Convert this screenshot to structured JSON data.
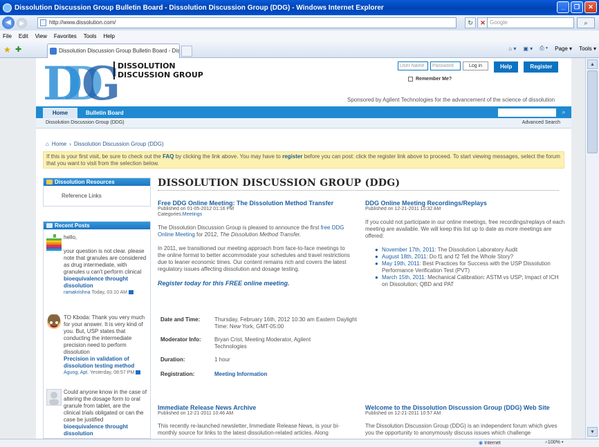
{
  "browser": {
    "window_title": "Dissolution Discussion Group Bulletin Board - Dissolution Discussion Group (DDG) - Windows Internet Explorer",
    "url": "http://www.dissolution.com/",
    "search_placeholder": "Google",
    "menu": [
      "File",
      "Edit",
      "View",
      "Favorites",
      "Tools",
      "Help"
    ],
    "tab_title": "Dissolution Discussion Group Bulletin Board - Dissolutio...",
    "cmd_page": "Page",
    "cmd_tools": "Tools",
    "status_zone": "Internet",
    "status_zoom": "100%"
  },
  "site": {
    "logo_text": "DDG",
    "brand_line1": "DISSOLUTION",
    "brand_line2": "DISCUSSION GROUP",
    "username_placeholder": "User Name",
    "password_placeholder": "Password",
    "login_label": "Log in",
    "help_label": "Help",
    "register_label": "Register",
    "remember_label": "Remember Me?",
    "sponsor": "Sponsored by Agilent Technologies for the advancement of the science of dissolution",
    "nav_home": "Home",
    "nav_bulletin": "Bulletin Board",
    "crumb": "Dissolution Discussion Group (DDG)",
    "advanced_search": "Advanced Search",
    "home_crumb_home": "Home",
    "home_crumb_sep": "›",
    "home_crumb_page": "Dissolution Discussion Group (DDG)",
    "notice_a": "If this is your first visit, be sure to check out the ",
    "notice_faq": "FAQ",
    "notice_b": " by clicking the link above. You may have to ",
    "notice_register": "register",
    "notice_c": " before you can post: click the register link above to proceed. To start viewing messages, select the forum that you want to visit from the selection below."
  },
  "sidebar": {
    "resources_title": "Dissolution Resources",
    "reference_links": "Reference Links",
    "recent_title": "Recent Posts",
    "posts": [
      {
        "text": "hello,\n\nyour question is not clear. please note that granules are considered as drug intermediate, with granules u can't perform clinical",
        "thread": "bioequivalence throught dissolution",
        "author": "ramakrishna",
        "when": "Today, 03:10 AM"
      },
      {
        "text": "TO Kboda: Thank you very much for your answer. It is very kind of you. But, USP states that conducting the intermediate precision need to perform dissolution",
        "thread": "Precision in validation of dissolution testing method",
        "author": "Agung, Apt.",
        "when": "Yesterday, 08:57 PM"
      },
      {
        "text": "Could anyone know in the case of altering the dosage form to oral granule from tablet, are the clinical trials obligated or can the case be justified",
        "thread": "bioequivalence throught dissolution",
        "author": "",
        "when": ""
      }
    ]
  },
  "main": {
    "title": "DISSOLUTION DISCUSSION GROUP (DDG)",
    "a1": {
      "title": "Free DDG Online Meeting: The Dissolution Method Transfer",
      "published": "Published on 01-05-2012 01:16 PM",
      "categories_label": "Categories:",
      "categories_value": "Meetings",
      "p1a": "The Dissolution Discussion Group is pleased to announce the first ",
      "p1link": "free DDG Online Meeting",
      "p1b": " for 2012, ",
      "p1i": "The Dissolution Method Transfer.",
      "p2": "In 2011, we transitioned our meeting approach from face-to-face meetings to the online format to better accommodate your schedules and travel restrictions due to leaner economic times. Our content remains rich and covers the latest regulatory issues affecting dissolution and dosage testing.",
      "reg_link": "Register today",
      "reg_rest": " for this FREE online meeting.",
      "details": [
        {
          "k": "Date and Time:",
          "v": "Thursday, February 16th, 2012 10:30 am Eastern Daylight Time: New York, GMT-05:00"
        },
        {
          "k": "Moderator Info:",
          "v": "Bryan Crist, Meeting Moderator, Agilent Technologies"
        },
        {
          "k": "Duration:",
          "v": "1 hour"
        },
        {
          "k": "Registration:",
          "v": "Meeting Information"
        }
      ]
    },
    "a2": {
      "title": "DDG Online Meeting Recordings/Replays",
      "published": "Published on 12-21-2011 10:32 AM",
      "p1": "If you could not participate in our online meetings, free recordings/replays of each meeting are available. We will keep this list up to date as more meetings are offered:",
      "items": [
        {
          "d": "November 17th, 2011",
          "t": ": The Dissolution Laboratory Audit"
        },
        {
          "d": "August 18th, 2011",
          "t": ": Do f1 and f2 Tell the Whole Story?"
        },
        {
          "d": "May 19th, 2011",
          "t": ": Best Practices for Success with the USP Dissolution Performance Verification Test (PVT)"
        },
        {
          "d": "March 15th, 2011",
          "t": ": Mechanical Calibration: ASTM vs USP; Impact of ICH on Dissolution; QBD and PAT"
        }
      ]
    },
    "a3": {
      "title": "Immediate Release News Archive",
      "published": "Published on 12-21-2011 10:46 AM",
      "p1": "This recently re-launched newsletter, Immediate Release News, is your bi-monthly source for links to the latest dissolution-related articles. Along"
    },
    "a4": {
      "title": "Welcome to the Dissolution Discussion Group (DDG) Web Site",
      "published": "Published on 12-21-2011 10:57 AM",
      "p1": "The Dissolution Discussion Group (DDG) is an independent forum which gives you the opportunity to anonymously discuss issues which challenge"
    }
  }
}
